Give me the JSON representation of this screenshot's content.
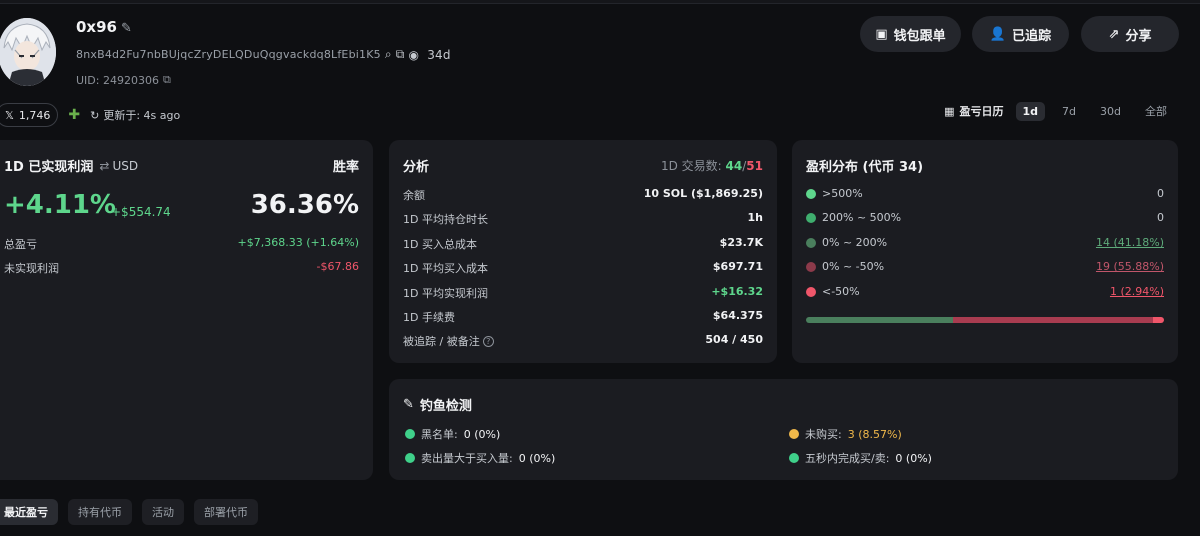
{
  "profile": {
    "name": "0x96",
    "address": "8nxB4d2Fu7nbBUjqcZryDELQDuQqgvackdq8LfEbi1K5",
    "age": "34d",
    "uid": "UID: 24920306"
  },
  "header_buttons": {
    "wallet_copy": "钱包跟单",
    "tracked": "已追踪",
    "share": "分享"
  },
  "social": {
    "followers": "1,746",
    "updated": "更新于: 4s ago"
  },
  "range": {
    "calendar_label": "盈亏日历",
    "options": [
      "1d",
      "7d",
      "30d",
      "全部"
    ],
    "selected": "1d"
  },
  "pnl_card": {
    "title": "1D 已实现利润",
    "currency": "USD",
    "winrate_label": "胜率",
    "pct": "+4.11%",
    "usd": "+$554.74",
    "winrate": "36.36%",
    "total_label": "总盈亏",
    "total_value": "+$7,368.33 (+1.64%)",
    "unrealized_label": "未实现利润",
    "unrealized_value": "-$67.86"
  },
  "analysis": {
    "title": "分析",
    "trades_label": "1D 交易数:",
    "trades_buy": "44",
    "trades_sep": "/",
    "trades_sell": "51",
    "rows": [
      {
        "label": "余额",
        "value": "10 SOL ($1,869.25)"
      },
      {
        "label": "1D 平均持仓时长",
        "value": "1h"
      },
      {
        "label": "1D 买入总成本",
        "value": "$23.7K"
      },
      {
        "label": "1D 平均买入成本",
        "value": "$697.71"
      },
      {
        "label": "1D 平均实现利润",
        "value": "+$16.32"
      },
      {
        "label": "1D 手续费",
        "value": "$64.375"
      },
      {
        "label": "被追踪 / 被备注",
        "value": "504 / 450"
      }
    ]
  },
  "distribution": {
    "title": "盈利分布 (代币 34)",
    "rows": [
      {
        "label": ">500%",
        "value": "0",
        "color": "#5ed68c"
      },
      {
        "label": "200% ~ 500%",
        "value": "0",
        "color": "#3fae6e"
      },
      {
        "label": "0% ~ 200%",
        "value": "14 (41.18%)",
        "color": "#4a7f5d"
      },
      {
        "label": "0% ~ -50%",
        "value": "19 (55.88%)",
        "color": "#8c3a4a"
      },
      {
        "label": "<-50%",
        "value": "1 (2.94%)",
        "color": "#f0566a"
      }
    ],
    "bar_fractions": [
      0.4118,
      0.5588,
      0.0294
    ]
  },
  "phishing": {
    "title": "钓鱼检测",
    "blacklist_label": "黑名单:",
    "blacklist_value": "0 (0%)",
    "not_bought_label": "未购买:",
    "not_bought_value": "3 (8.57%)",
    "sold_more_label": "卖出量大于买入量:",
    "sold_more_value": "0 (0%)",
    "fast_label": "五秒内完成买/卖:",
    "fast_value": "0 (0%)"
  },
  "tabs": [
    "最近盈亏",
    "持有代币",
    "活动",
    "部署代币"
  ]
}
